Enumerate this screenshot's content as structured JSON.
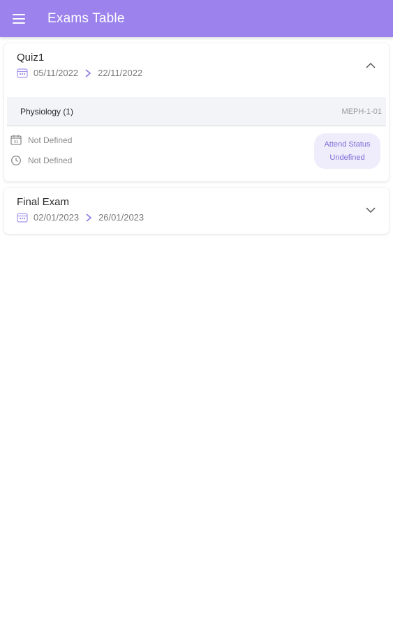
{
  "appbar": {
    "title": "Exams Table",
    "menu_icon": "menu-icon",
    "color": "#9b82ec"
  },
  "exams": [
    {
      "title": "Quiz1",
      "start_date": "05/11/2022",
      "end_date": "22/11/2022",
      "expanded": true,
      "subjects": [
        {
          "name": "Physiology (1)",
          "code": "MEPH-1-01",
          "date": "Not Defined",
          "time": "Not Defined",
          "attend_status_label": "Attend Status",
          "attend_status_value": "Undefined"
        }
      ]
    },
    {
      "title": "Final Exam",
      "start_date": "02/01/2023",
      "end_date": "26/01/2023",
      "expanded": false
    }
  ],
  "colors": {
    "accent": "#9b82ec",
    "badge_bg": "#efedfc",
    "badge_text": "#7f6bd6"
  }
}
